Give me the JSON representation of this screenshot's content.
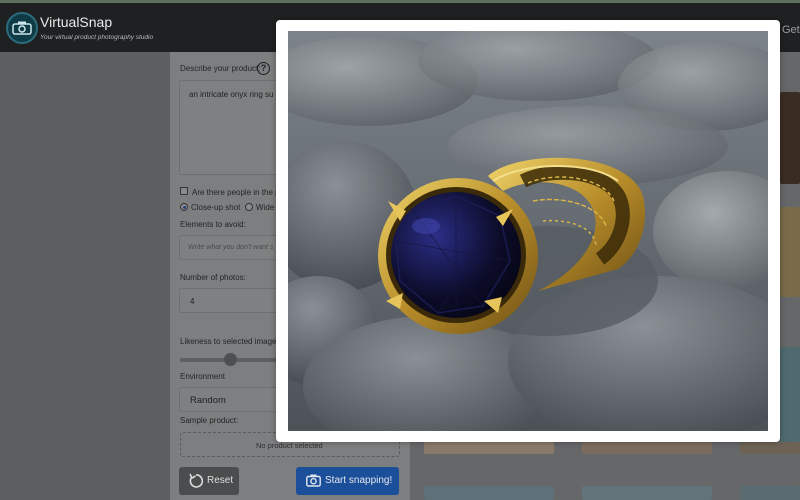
{
  "header": {
    "app_title": "VirtualSnap",
    "app_subtitle": "Your virtual product photography studio",
    "header_link_partial": "Get"
  },
  "form": {
    "describe_label": "Describe your product:",
    "describe_help_icon": "?",
    "description_value": "an intricate onyx ring su",
    "people_question_partial": "Are there people in the pi",
    "shot_options": [
      {
        "label": "Close-up shot",
        "selected": true
      },
      {
        "label": "Wide",
        "selected": false
      }
    ],
    "avoid_label": "Elements to avoid:",
    "avoid_placeholder_partial": "Write what you don't want s",
    "num_photos_label": "Number of photos:",
    "num_photos_value": "4",
    "likeness_label_partial": "Likeness to selected image (r",
    "likeness_level": 0.5,
    "environment_label": "Environment",
    "environment_value": "Random",
    "sample_label": "Sample product:",
    "sample_empty_text": "No product selected",
    "reset_label": "Reset",
    "start_label": "Start snapping!"
  },
  "icons": {
    "logo": "camera-icon",
    "reset": "reset-icon",
    "start": "camera-icon",
    "help": "question-circle-icon"
  },
  "colors": {
    "start_button": "#1c4f9a",
    "modal_background": "#ffffff"
  }
}
